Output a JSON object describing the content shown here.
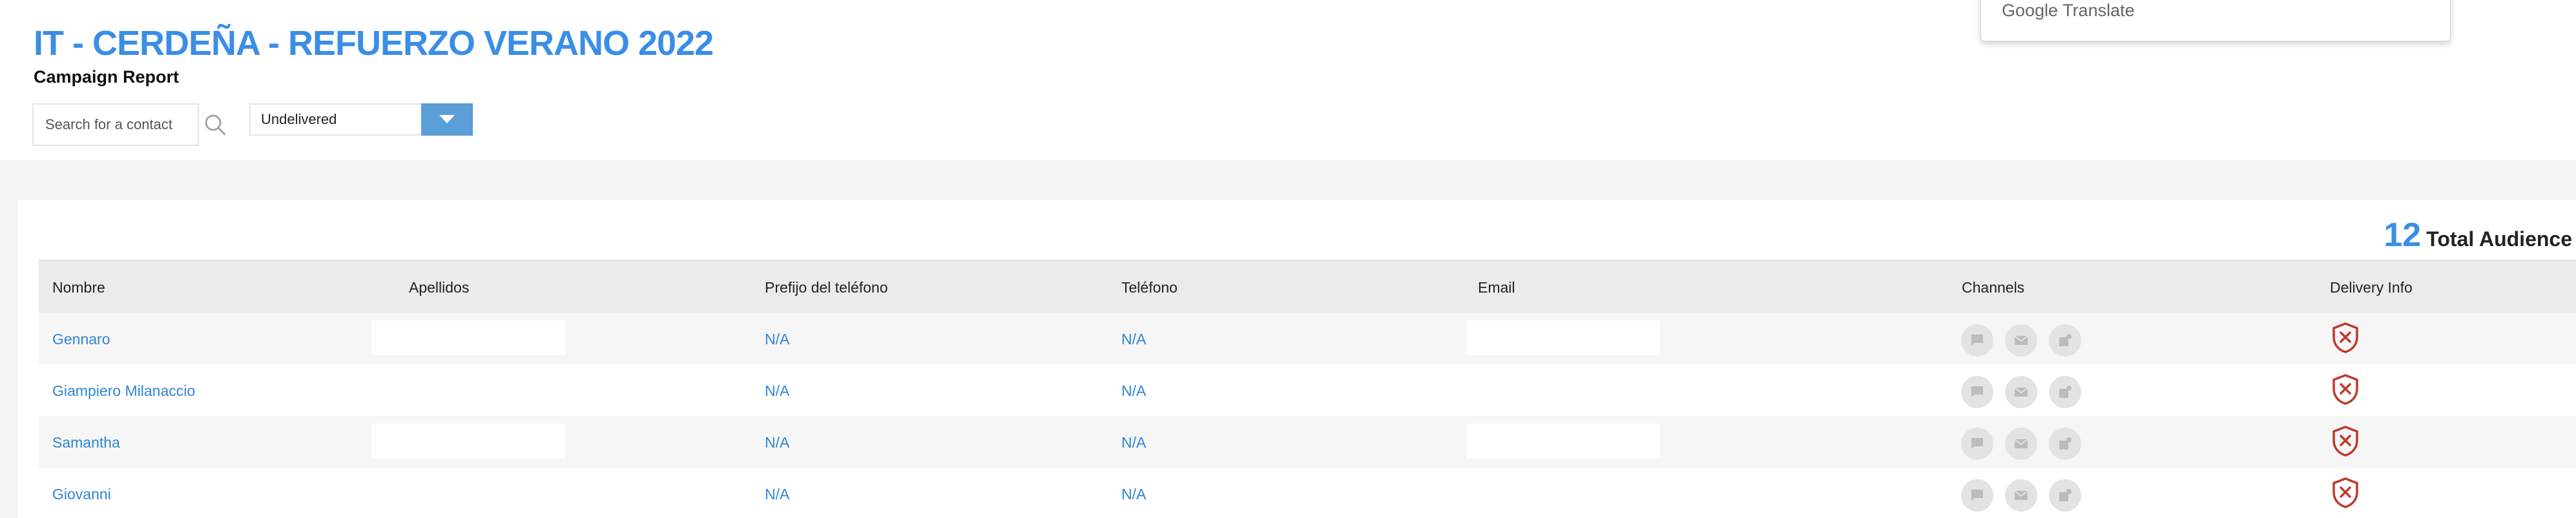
{
  "header": {
    "title": "IT - CERDEÑA - REFUERZO VERANO 2022",
    "subtitle": "Campaign Report"
  },
  "search": {
    "placeholder": "Search for a contact",
    "value": ""
  },
  "filter": {
    "selected": "Undelivered"
  },
  "translate_popup": {
    "brand": "Google Translate"
  },
  "audience": {
    "count": "12",
    "label": "Total Audience"
  },
  "table": {
    "columns": [
      "Nombre",
      "Apellidos",
      "Prefijo del teléfono",
      "Teléfono",
      "Email",
      "Channels",
      "Delivery Info"
    ],
    "rows": [
      {
        "nombre": "Gennaro",
        "apellidos": "",
        "prefijo": "N/A",
        "telefono": "N/A",
        "email": ""
      },
      {
        "nombre": "Giampiero Milanaccio",
        "apellidos": "",
        "prefijo": "N/A",
        "telefono": "N/A",
        "email": ""
      },
      {
        "nombre": "Samantha",
        "apellidos": "",
        "prefijo": "N/A",
        "telefono": "N/A",
        "email": ""
      },
      {
        "nombre": "Giovanni",
        "apellidos": "",
        "prefijo": "N/A",
        "telefono": "N/A",
        "email": ""
      }
    ]
  },
  "icons": {
    "channels": [
      "chat-icon",
      "email-icon",
      "push-notification-icon"
    ],
    "delivery": "delivery-failed-shield-icon",
    "search": "search-icon",
    "dropdown": "chevron-down-icon"
  },
  "colors": {
    "accent": "#3a8ee6",
    "link": "#2f86d6",
    "dropdown_button": "#5b9fd8",
    "delivery_failed": "#c0392b",
    "channel_icon_bg": "#e3e3e3"
  }
}
